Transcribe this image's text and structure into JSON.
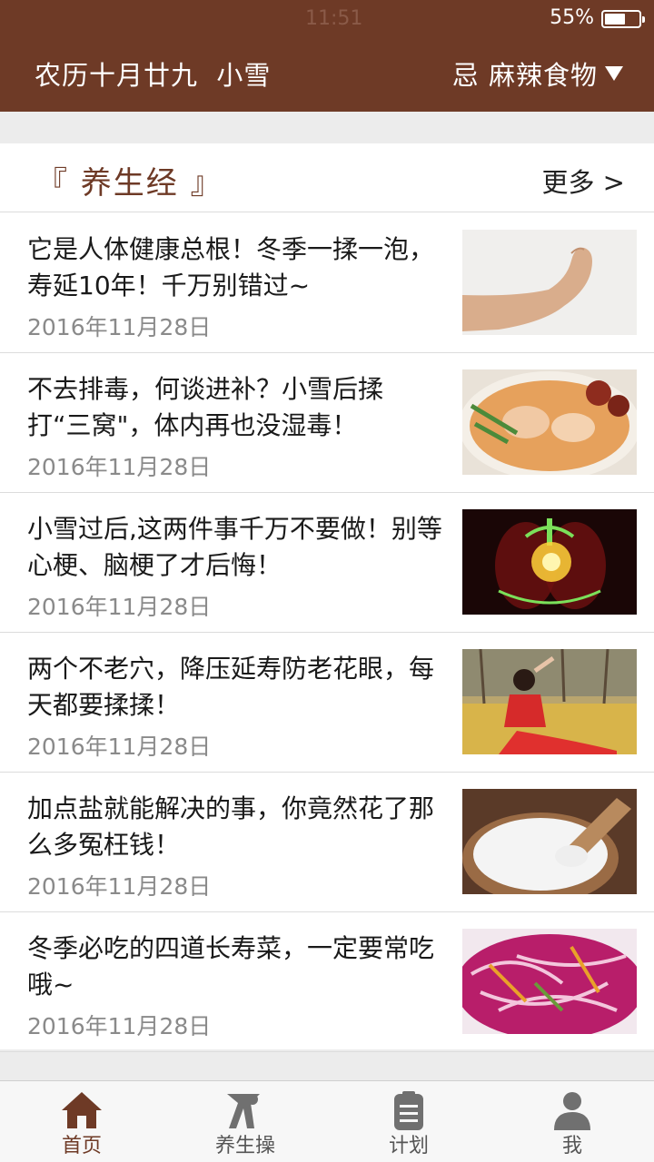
{
  "status": {
    "time": "11:51",
    "battery": "55%"
  },
  "header": {
    "lunar_date": "农历十月廿九  小雪",
    "avoid": "忌 麻辣食物"
  },
  "section": {
    "title": "『 养生经 』",
    "more": "更多 >"
  },
  "articles": [
    {
      "title": "它是人体健康总根！冬季一揉一泡，寿延10年！千万别错过~",
      "date": "2016年11月28日",
      "image": "foot-against-wall"
    },
    {
      "title": "不去排毒，何谈进补？小雪后揉打“三窝\"，体内再也没湿毒！",
      "date": "2016年11月28日",
      "image": "soup-bowl"
    },
    {
      "title": "小雪过后,这两件事千万不要做！别等心梗、脑梗了才后悔！",
      "date": "2016年11月28日",
      "image": "glowing-heart-xray"
    },
    {
      "title": "两个不老穴，降压延寿防老花眼，每天都要揉揉！",
      "date": "2016年11月28日",
      "image": "woman-in-autumn-leaves"
    },
    {
      "title": "加点盐就能解决的事，你竟然花了那么多冤枉钱！",
      "date": "2016年11月28日",
      "image": "salt-bowl-with-scoop"
    },
    {
      "title": "冬季必吃的四道长寿菜，一定要常吃哦~",
      "date": "2016年11月28日",
      "image": "red-cabbage-salad"
    }
  ],
  "tabs": [
    {
      "label": "首页",
      "icon": "home-icon",
      "active": true
    },
    {
      "label": "养生操",
      "icon": "exercise-icon",
      "active": false
    },
    {
      "label": "计划",
      "icon": "clipboard-icon",
      "active": false
    },
    {
      "label": "我",
      "icon": "person-icon",
      "active": false
    }
  ],
  "colors": {
    "brand": "#6e3a26",
    "background": "#ececec",
    "divider": "#dcdcdc"
  }
}
